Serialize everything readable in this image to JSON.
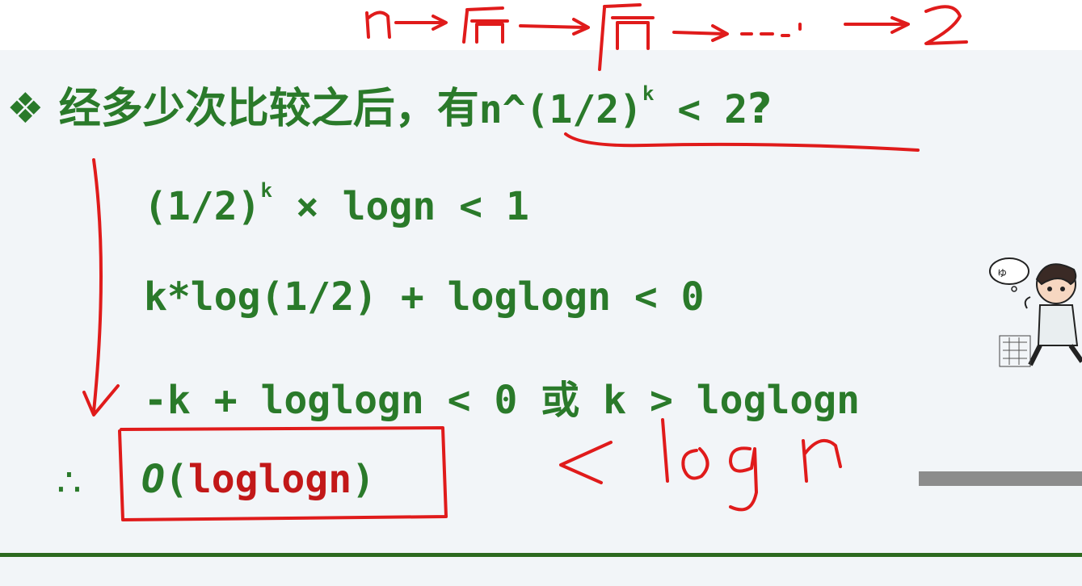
{
  "slide": {
    "bullet_symbol": "❖",
    "question_prefix": "经多少次比较之后，有",
    "question_math": "n^(1/2)",
    "question_sup": "k",
    "question_suffix": " < 2",
    "question_mark": "?",
    "step1_a": "(1/2)",
    "step1_sup": "k",
    "step1_b": " × logn < 1",
    "step2": "k*log(1/2) + loglogn < 0",
    "step3": "-k + loglogn < 0 或 k > loglogn",
    "therefore": "∴",
    "result_o": "O",
    "result_paren_open": "(",
    "result_inner": "loglogn",
    "result_paren_close": ")"
  },
  "annotations": {
    "top_chain": "n→后→后→…→2",
    "handwritten_note": "< logn",
    "ink_color": "#e01b1b"
  },
  "colors": {
    "text_green": "#2a7a2a",
    "result_red": "#c21818",
    "rule_green": "#2c6a1f",
    "slide_bg": "#f2f5f8"
  }
}
